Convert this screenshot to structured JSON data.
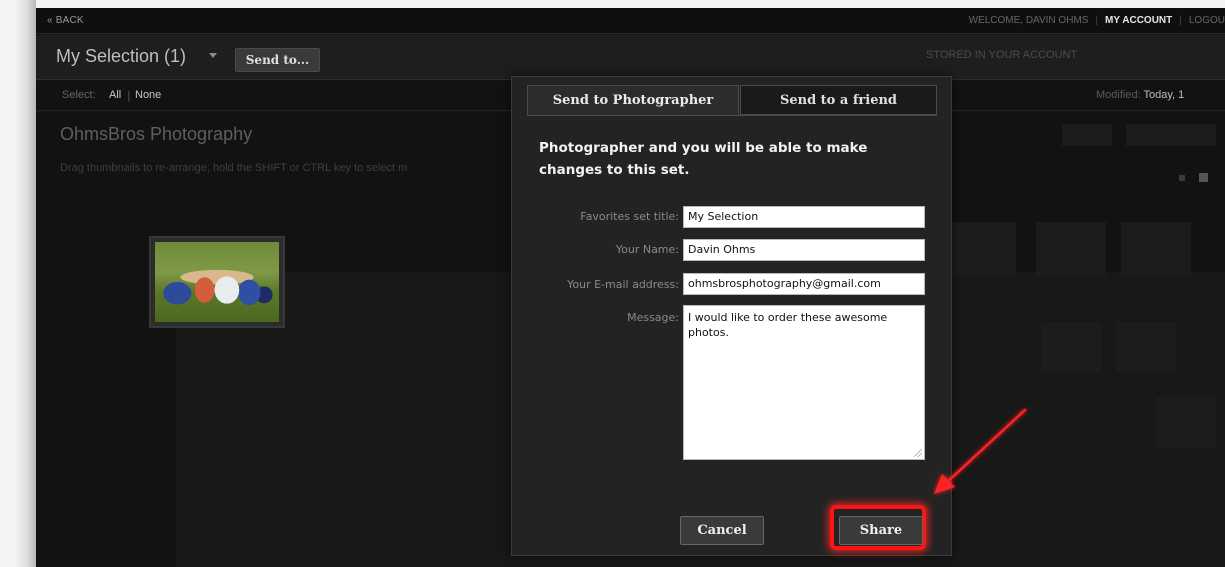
{
  "topbar": {
    "back_label": "« BACK",
    "welcome": "WELCOME, DAVIN OHMS",
    "my_account": "MY ACCOUNT",
    "logout": "LOGOU"
  },
  "selection_bar": {
    "title": "My Selection (1)",
    "send_to_label": "Send to...",
    "stored_text": "STORED IN YOUR ACCOUNT"
  },
  "select_row": {
    "label": "Select:",
    "all": "All",
    "separator": "|",
    "none": "None",
    "modified_label": "Modified:",
    "modified_value": "Today, 1"
  },
  "gallery": {
    "title": "OhmsBros Photography",
    "drag_hint": "Drag thumbnails to re-arrange; hold the SHIFT or CTRL key to select m"
  },
  "modal": {
    "tabs": [
      {
        "label": "Send to Photographer",
        "active": true
      },
      {
        "label": "Send to a friend",
        "active": false
      }
    ],
    "intro": "Photographer and you will be able to make changes to this set.",
    "fields": {
      "title_label": "Favorites set title:",
      "title_value": "My Selection",
      "name_label": "Your Name:",
      "name_value": "Davin Ohms",
      "email_label": "Your E-mail address:",
      "email_value": "ohmsbrosphotography@gmail.com",
      "message_label": "Message:",
      "message_value": "I would like to order these awesome photos."
    },
    "cancel_label": "Cancel",
    "share_label": "Share"
  },
  "colors": {
    "highlight": "#ff1414",
    "background": "#161616",
    "modal": "#232323"
  },
  "icons": {
    "dropdown": "chevron-down-icon",
    "annotation": "red-arrow-icon",
    "resize": "resize-grip-icon"
  }
}
